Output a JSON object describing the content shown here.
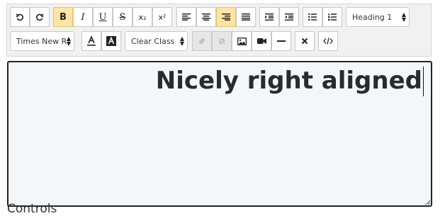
{
  "toolbar": {
    "block_format": "Heading 1",
    "font_family": "Times New R",
    "class_select": "Clear Class",
    "buttons": {
      "bold": "B",
      "italic": "I",
      "underline": "U",
      "strike": "S",
      "subscript": "x₂",
      "superscript": "x²"
    },
    "active": [
      "bold",
      "align-right"
    ]
  },
  "editor": {
    "content": "Nicely right aligned"
  },
  "section_heading": "Controls",
  "colors": {
    "active_bg": "#ffe5a3",
    "editor_bg": "#f4f7fa",
    "toolbar_bg": "#f1f1f1"
  }
}
